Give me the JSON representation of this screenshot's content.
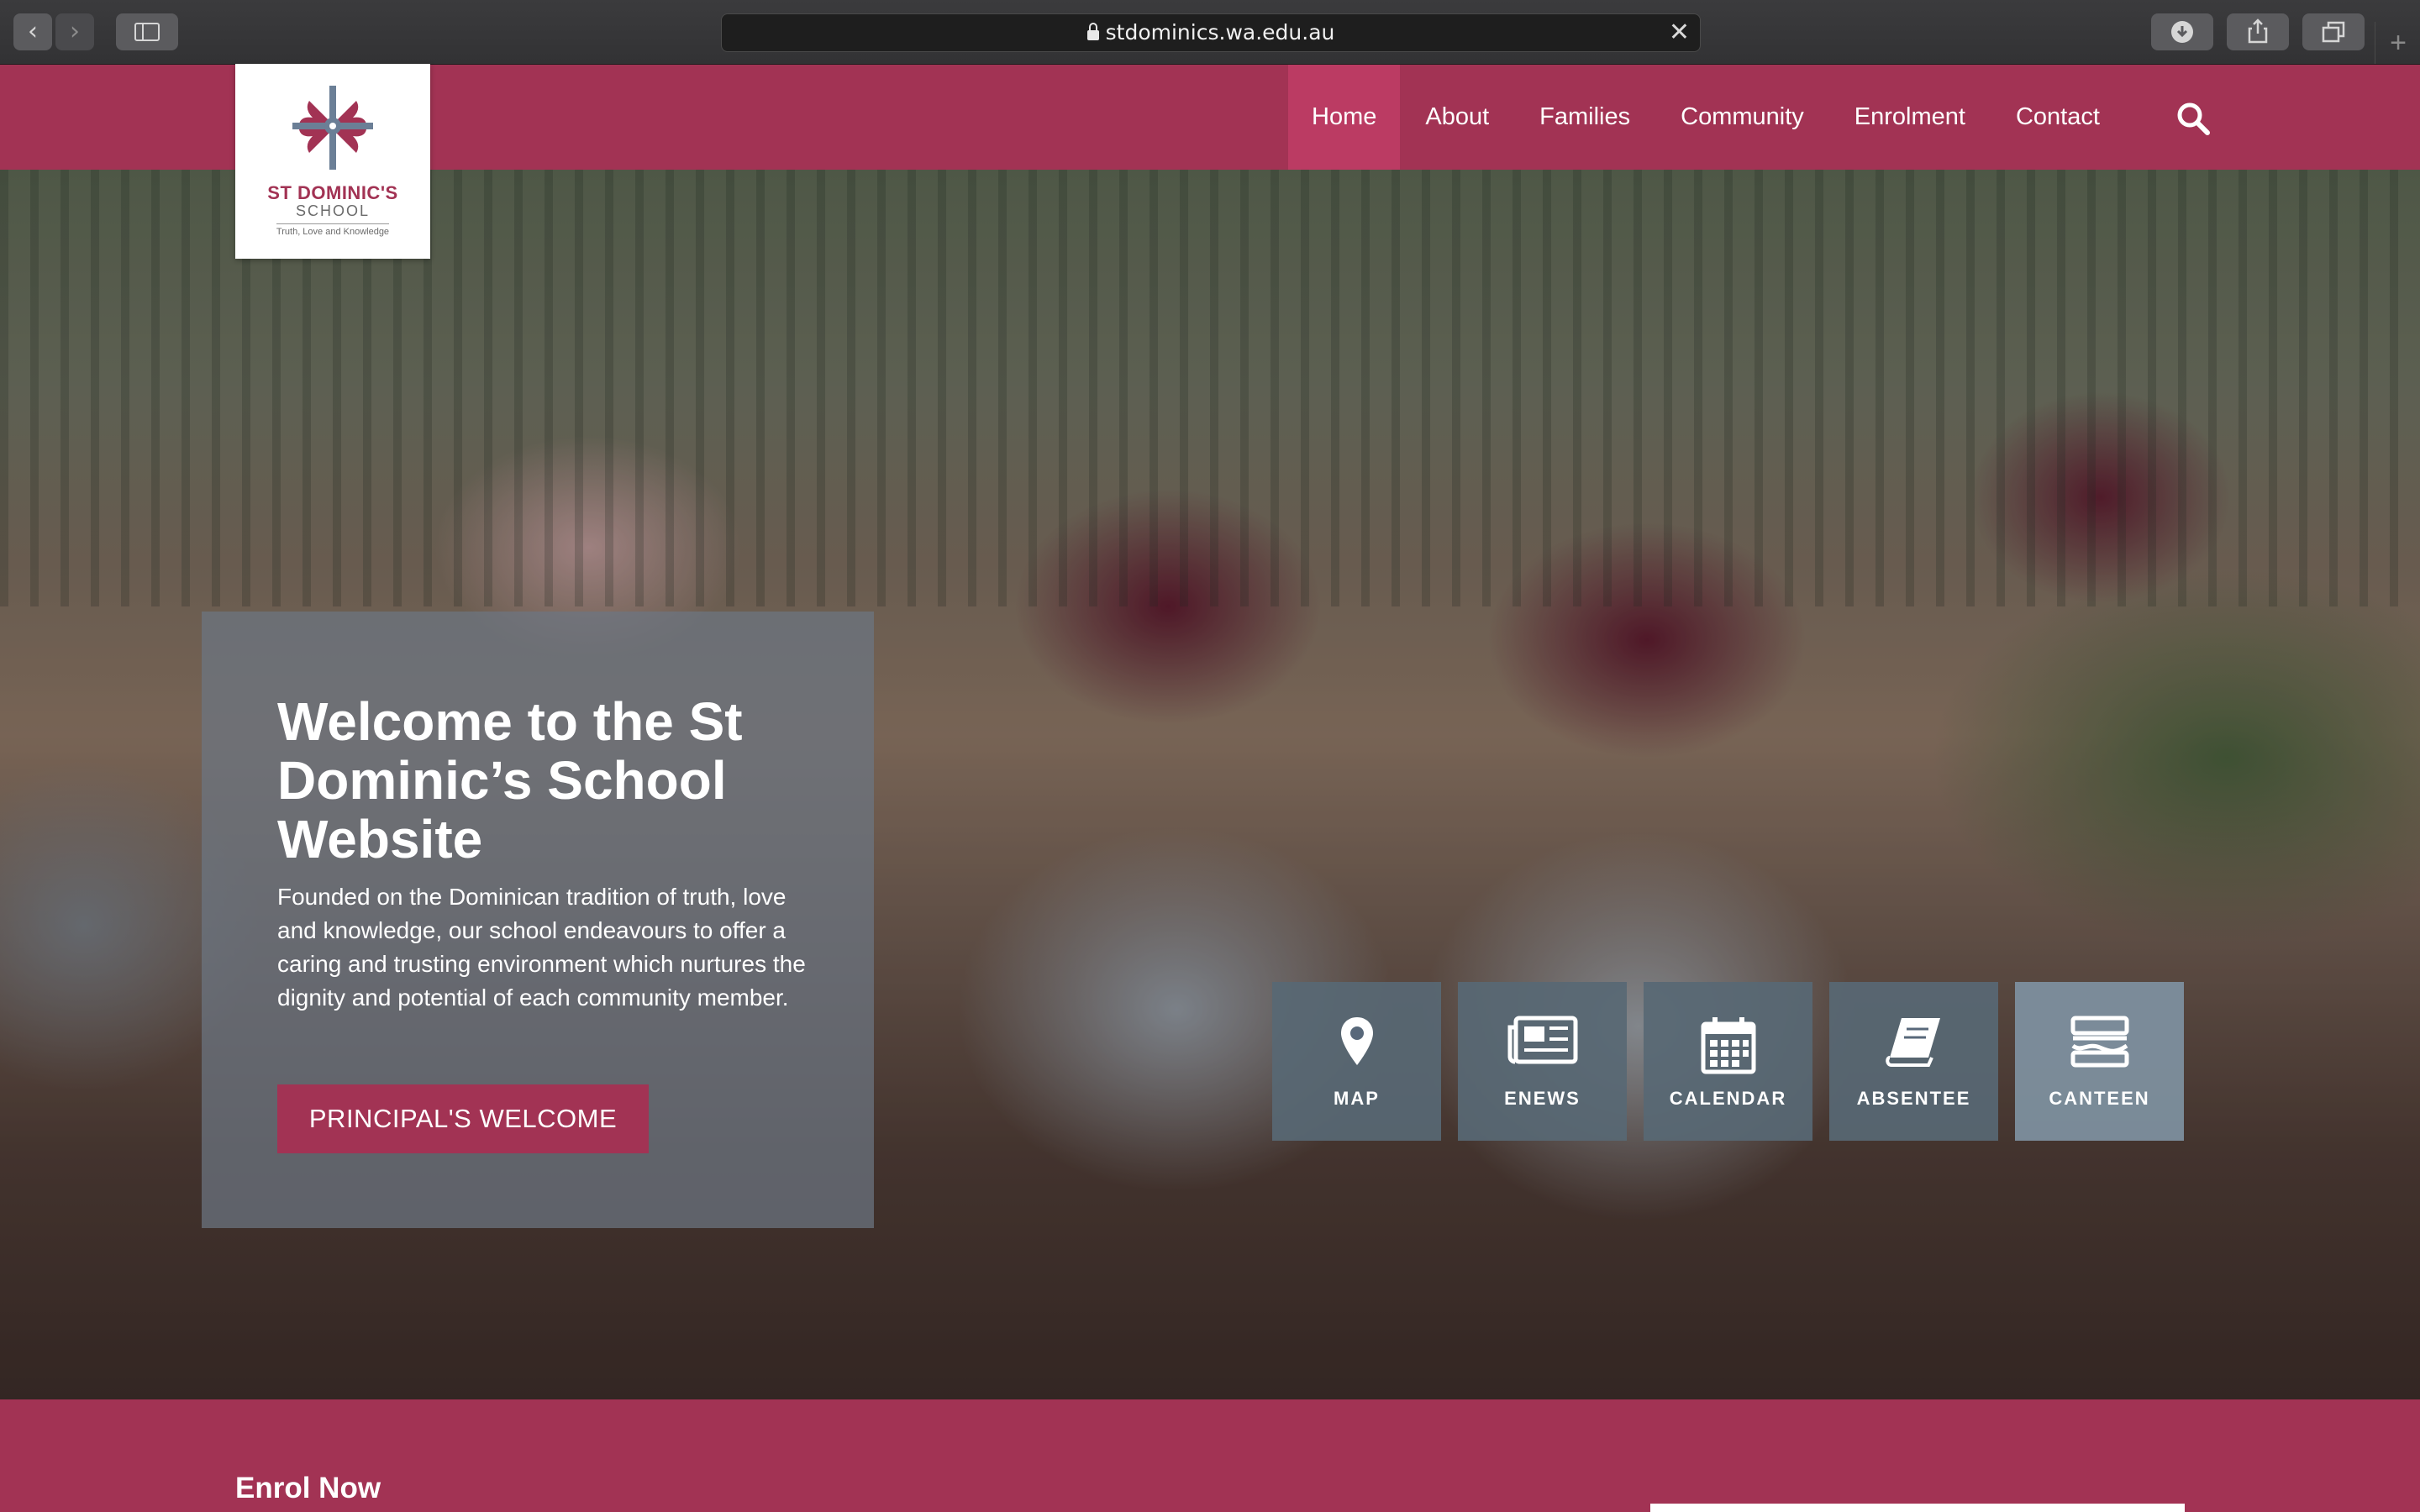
{
  "browser": {
    "url": "stdominics.wa.edu.au",
    "back_glyph": "‹",
    "forward_glyph": "›",
    "clear_glyph": "✕",
    "new_tab_glyph": "+"
  },
  "site": {
    "logo": {
      "name": "ST DOMINIC'S",
      "sub": "SCHOOL",
      "tagline": "Truth, Love and Knowledge"
    },
    "nav": [
      {
        "label": "Home",
        "active": true
      },
      {
        "label": "About"
      },
      {
        "label": "Families"
      },
      {
        "label": "Community"
      },
      {
        "label": "Enrolment"
      },
      {
        "label": "Contact"
      }
    ],
    "brand_color": "#a23354"
  },
  "hero": {
    "title": "Welcome to the St Dominic’s School Website",
    "text": "Founded on the Dominican tradition of truth, love and knowledge, our school endeavours to offer a caring and trusting environment which nurtures the dignity and potential of each community member.",
    "button": "PRINCIPAL'S WELCOME"
  },
  "quick_links": [
    {
      "label": "MAP",
      "icon": "map-pin-icon"
    },
    {
      "label": "ENEWS",
      "icon": "newspaper-icon"
    },
    {
      "label": "CALENDAR",
      "icon": "calendar-icon"
    },
    {
      "label": "ABSENTEE",
      "icon": "book-icon"
    },
    {
      "label": "CANTEEN",
      "icon": "canteen-icon"
    }
  ],
  "footer": {
    "enrol_title": "Enrol Now"
  }
}
